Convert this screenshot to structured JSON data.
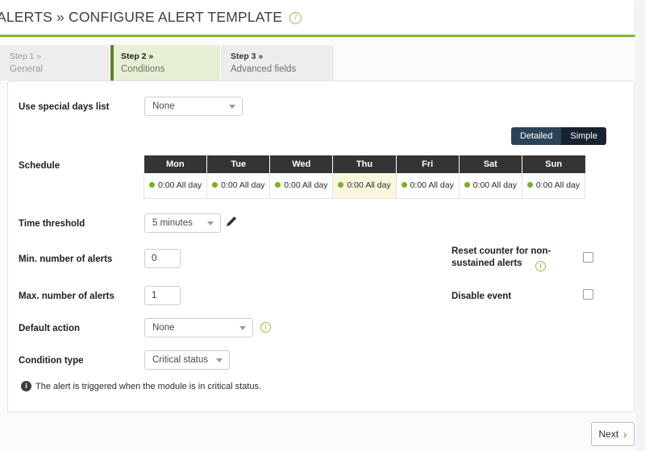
{
  "header": {
    "title": "ALERTS » CONFIGURE ALERT TEMPLATE",
    "help_icon": "question-circle-icon",
    "accent_color": "#82b92e"
  },
  "steps": [
    {
      "number": "Step 1 »",
      "label": "General",
      "state": "done"
    },
    {
      "number": "Step 2 »",
      "label": "Conditions",
      "state": "active"
    },
    {
      "number": "Step 3 »",
      "label": "Advanced fields",
      "state": "upcoming"
    }
  ],
  "form": {
    "special_days": {
      "label": "Use special days list",
      "value": "None"
    },
    "schedule": {
      "label": "Schedule"
    },
    "time_threshold": {
      "label": "Time threshold",
      "value": "5 minutes",
      "edit_icon": "pencil-icon"
    },
    "min_alerts": {
      "label": "Min. number of alerts",
      "value": "0"
    },
    "max_alerts": {
      "label": "Max. number of alerts",
      "value": "1"
    },
    "default_action": {
      "label": "Default action",
      "value": "None",
      "info_icon": "info-circle-icon"
    },
    "condition_type": {
      "label": "Condition type",
      "value": "Critical status"
    },
    "reset_counter": {
      "label_line1": "Reset counter for non-",
      "label_line2": "sustained alerts",
      "info_icon": "info-circle-icon",
      "checked": false
    },
    "disable_event": {
      "label": "Disable event",
      "checked": false
    },
    "note": {
      "icon": "info-filled-icon",
      "text": "The alert is triggered when the module is in critical status."
    }
  },
  "view_toggle": {
    "detailed": "Detailed",
    "simple": "Simple",
    "selected": "Detailed",
    "selected_color": "#2c4257",
    "unselected_color": "#19232f"
  },
  "schedule_table": {
    "columns": [
      "Mon",
      "Tue",
      "Wed",
      "Thu",
      "Fri",
      "Sat",
      "Sun"
    ],
    "cells": [
      {
        "day": "Mon",
        "text": "0:00 All day",
        "status_color": "#7bb026",
        "highlighted": false
      },
      {
        "day": "Tue",
        "text": "0:00 All day",
        "status_color": "#7bb026",
        "highlighted": false
      },
      {
        "day": "Wed",
        "text": "0:00 All day",
        "status_color": "#7bb026",
        "highlighted": false
      },
      {
        "day": "Thu",
        "text": "0:00 All day",
        "status_color": "#7bb026",
        "highlighted": true
      },
      {
        "day": "Fri",
        "text": "0:00 All day",
        "status_color": "#7bb026",
        "highlighted": false
      },
      {
        "day": "Sat",
        "text": "0:00 All day",
        "status_color": "#7bb026",
        "highlighted": false
      },
      {
        "day": "Sun",
        "text": "0:00 All day",
        "status_color": "#7bb026",
        "highlighted": false
      }
    ],
    "highlight_color": "#fbf7dd"
  },
  "footer": {
    "next_label": "Next",
    "next_chevron": "chevron-right-icon"
  }
}
